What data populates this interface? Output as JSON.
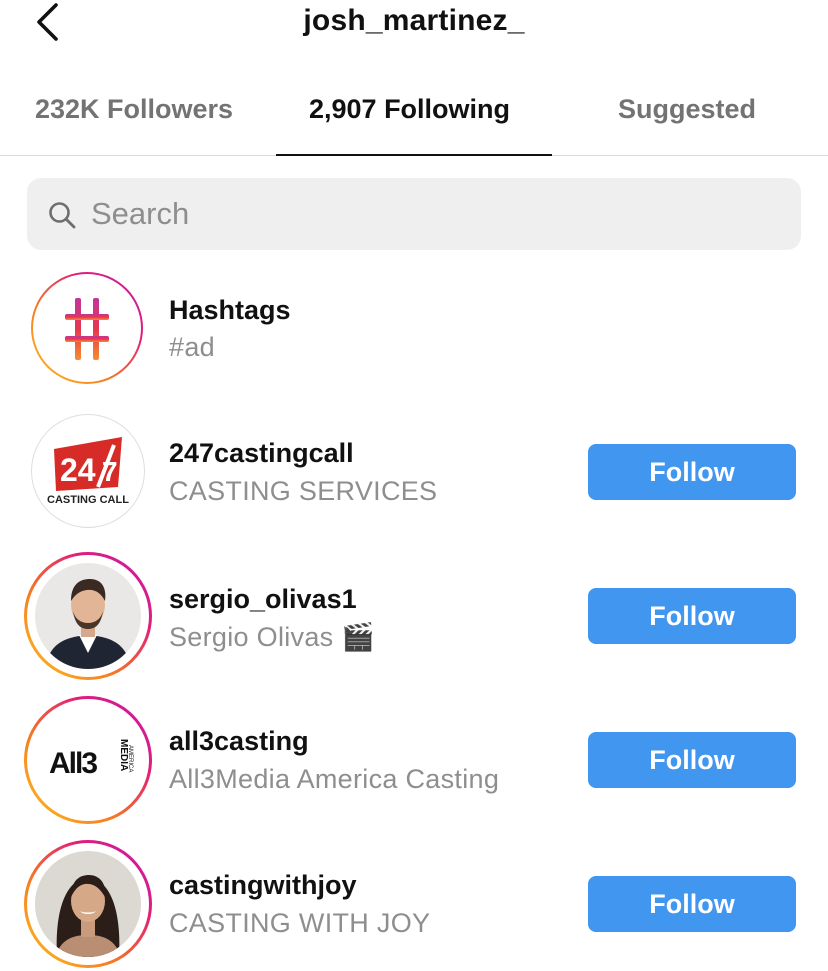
{
  "header": {
    "title": "josh_martinez_",
    "back_icon": "chevron-left-icon"
  },
  "tabs": [
    {
      "label": "232K Followers",
      "active": false
    },
    {
      "label": "2,907 Following",
      "active": true
    },
    {
      "label": "Suggested",
      "active": false
    }
  ],
  "search": {
    "placeholder": "Search",
    "icon": "search-icon"
  },
  "list": [
    {
      "username": "Hashtags",
      "subtitle": "#ad",
      "avatar": "hashtag-icon",
      "ring": "gradient-ring",
      "button": null
    },
    {
      "username": "247castingcall",
      "subtitle": "CASTING SERVICES",
      "avatar": "247-casting-call-logo",
      "ring": "none",
      "button": "Follow",
      "logo_text": {
        "number": "24",
        "slash_digit": "7",
        "caption": "CASTING CALL"
      }
    },
    {
      "username": "sergio_olivas1",
      "subtitle": "Sergio Olivas 🎬",
      "avatar": "profile-photo-man",
      "ring": "story-ring",
      "button": "Follow"
    },
    {
      "username": "all3casting",
      "subtitle": "All3Media America Casting",
      "avatar": "all3media-logo",
      "ring": "story-ring",
      "button": "Follow",
      "logo_text": {
        "mark": "All3",
        "side": "MEDIA",
        "side_small": "AMERICA"
      }
    },
    {
      "username": "castingwithjoy",
      "subtitle": "CASTING WITH JOY",
      "avatar": "profile-photo-woman",
      "ring": "story-ring",
      "button": "Follow"
    }
  ],
  "colors": {
    "follow_button": "#4196f0",
    "muted_text": "#8e8e8e",
    "ring_gradient": [
      "#fdc324",
      "#f77e20",
      "#e11e75",
      "#c516b9"
    ]
  }
}
